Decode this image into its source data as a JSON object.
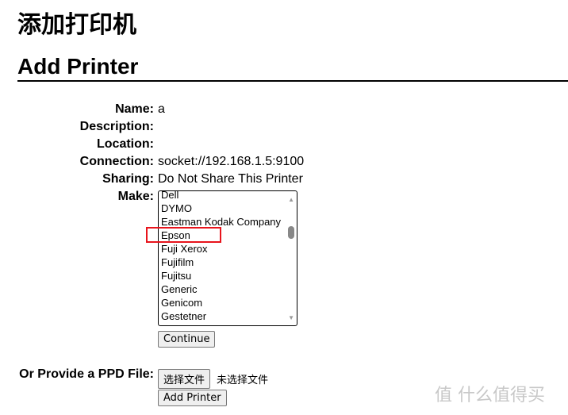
{
  "page": {
    "title_cn": "添加打印机",
    "title_en": "Add Printer"
  },
  "form": {
    "name_label": "Name:",
    "name_value": "a",
    "description_label": "Description:",
    "description_value": "",
    "location_label": "Location:",
    "location_value": "",
    "connection_label": "Connection:",
    "connection_value": "socket://192.168.1.5:9100",
    "sharing_label": "Sharing:",
    "sharing_value": "Do Not Share This Printer",
    "make_label": "Make:",
    "make_options": [
      "Dell",
      "DYMO",
      "Eastman Kodak Company",
      "Epson",
      "Fuji Xerox",
      "Fujifilm",
      "Fujitsu",
      "Generic",
      "Genicom",
      "Gestetner"
    ],
    "highlighted_make": "Epson",
    "continue_label": "Continue",
    "ppd_label": "Or Provide a PPD File:",
    "choose_file_label": "选择文件",
    "no_file_text": "未选择文件",
    "add_printer_label": "Add Printer"
  },
  "watermark": "值 什么值得买"
}
